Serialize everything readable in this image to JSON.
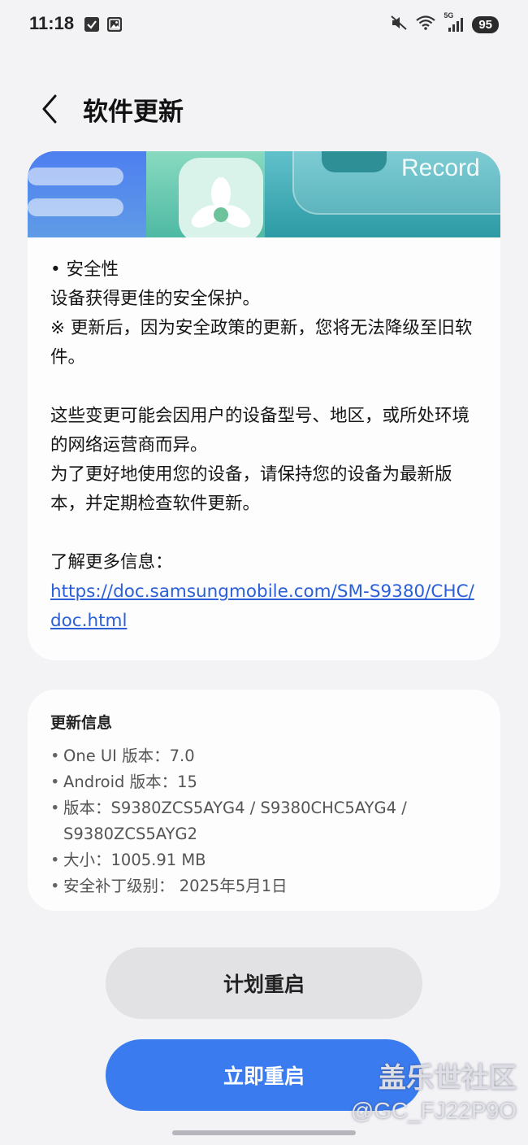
{
  "status_bar": {
    "time": "11:18",
    "battery": "95",
    "network": "5G",
    "icons": [
      "checkbox-notification-icon",
      "gallery-notification-icon",
      "mute-icon",
      "wifi-icon",
      "signal-icon"
    ]
  },
  "header": {
    "title": "软件更新"
  },
  "banner": {
    "record_label": "Record"
  },
  "notes": {
    "security_heading": "• 安全性",
    "security_desc": "设备获得更佳的安全保护。",
    "security_note": "※ 更新后，因为安全政策的更新，您将无法降级至旧软件。",
    "variation_notice": "这些变更可能会因用户的设备型号、地区，或所处环境的网络运营商而异。",
    "keep_updated": "为了更好地使用您的设备，请保持您的设备为最新版本，并定期检查软件更新。",
    "more_info_label": "了解更多信息：",
    "more_info_url": "https://doc.samsungmobile.com/SM-S9380/CHC/doc.html"
  },
  "update_info": {
    "title": "更新信息",
    "items": [
      "One UI 版本：7.0",
      "Android 版本：15",
      "版本：S9380ZCS5AYG4 / S9380CHC5AYG4 / S9380ZCS5AYG2",
      "大小：1005.91 MB",
      "安全补丁级别： 2025年5月1日"
    ]
  },
  "buttons": {
    "schedule_restart": "计划重启",
    "restart_now": "立即重启"
  },
  "watermark": {
    "line1": "盖乐世社区",
    "line2": "@GC_FJ22P9O"
  },
  "colors": {
    "primary_button": "#3a7cf0",
    "secondary_button": "#e2e2e5",
    "link": "#2a5fd8",
    "background": "#f3f3f6"
  }
}
